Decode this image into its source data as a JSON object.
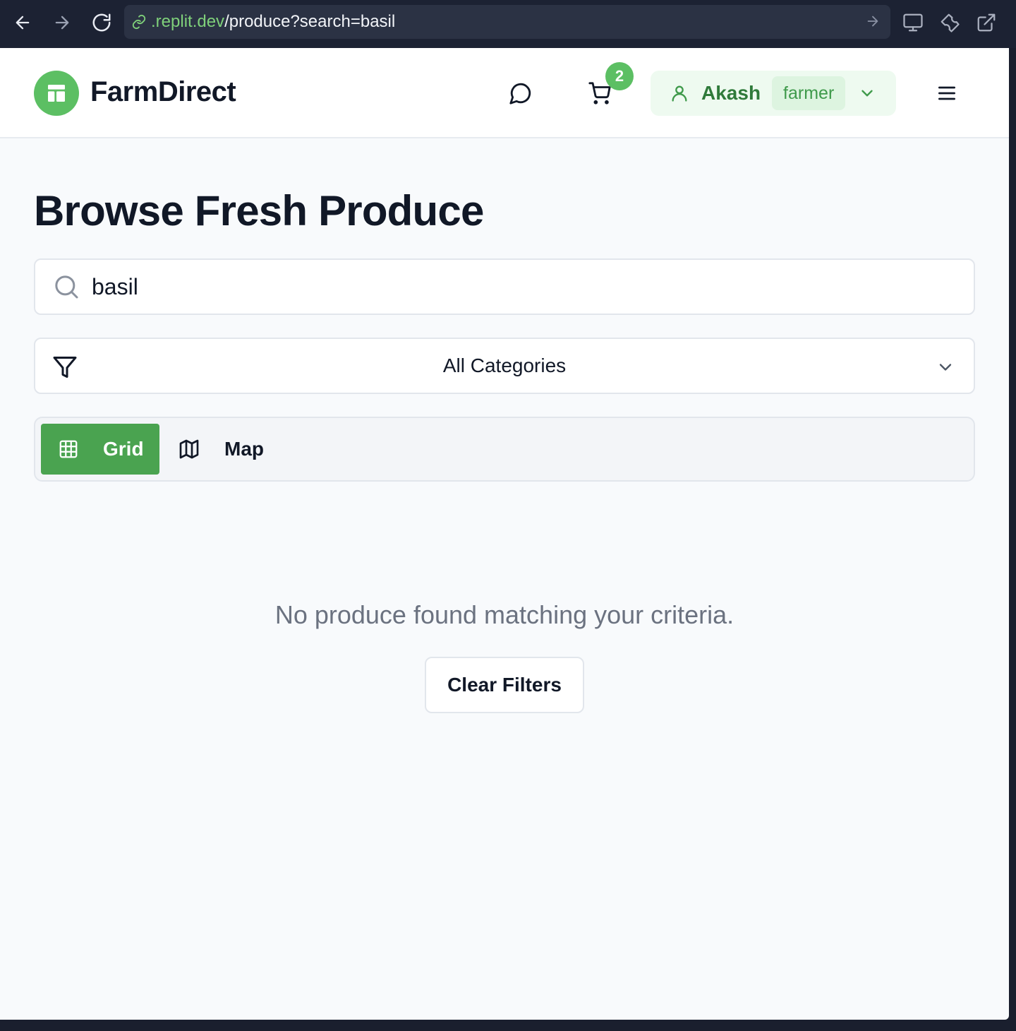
{
  "browser": {
    "url_domain": ".replit.dev",
    "url_path": "/produce?search=basil"
  },
  "header": {
    "brand": "FarmDirect",
    "cart_count": "2",
    "user_name": "Akash",
    "user_role": "farmer"
  },
  "main": {
    "title": "Browse Fresh Produce",
    "search_value": "basil",
    "category_selected": "All Categories",
    "view_tabs": [
      {
        "label": "Grid",
        "active": true
      },
      {
        "label": "Map",
        "active": false
      }
    ],
    "empty_message": "No produce found matching your criteria.",
    "clear_button": "Clear Filters"
  },
  "colors": {
    "accent": "#5cbf63",
    "accent_dark": "#4aa350",
    "chrome_bg": "#1c2233",
    "page_bg": "#f8fafc"
  }
}
